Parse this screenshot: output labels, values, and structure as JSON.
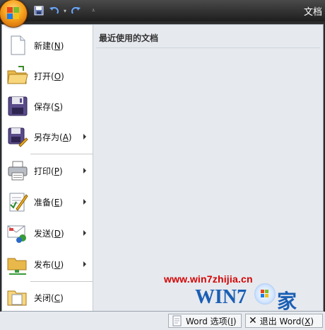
{
  "titlebar": {
    "title": "文档"
  },
  "menu_items": [
    {
      "label": "新建",
      "key": "N",
      "submenu": false
    },
    {
      "label": "打开",
      "key": "O",
      "submenu": false
    },
    {
      "label": "保存",
      "key": "S",
      "submenu": false
    },
    {
      "label": "另存为",
      "key": "A",
      "submenu": true
    },
    {
      "label": "打印",
      "key": "P",
      "submenu": true
    },
    {
      "label": "准备",
      "key": "E",
      "submenu": true
    },
    {
      "label": "发送",
      "key": "D",
      "submenu": true
    },
    {
      "label": "发布",
      "key": "U",
      "submenu": true
    },
    {
      "label": "关闭",
      "key": "C",
      "submenu": false
    }
  ],
  "recent": {
    "title": "最近使用的文档"
  },
  "bottom": {
    "options": {
      "label": "Word 选项",
      "key": "I"
    },
    "exit": {
      "label": "退出 Word",
      "key": "X"
    }
  },
  "watermark": {
    "url": "www.win7zhijia.cn",
    "brand": "WIN7",
    "home": "家"
  }
}
